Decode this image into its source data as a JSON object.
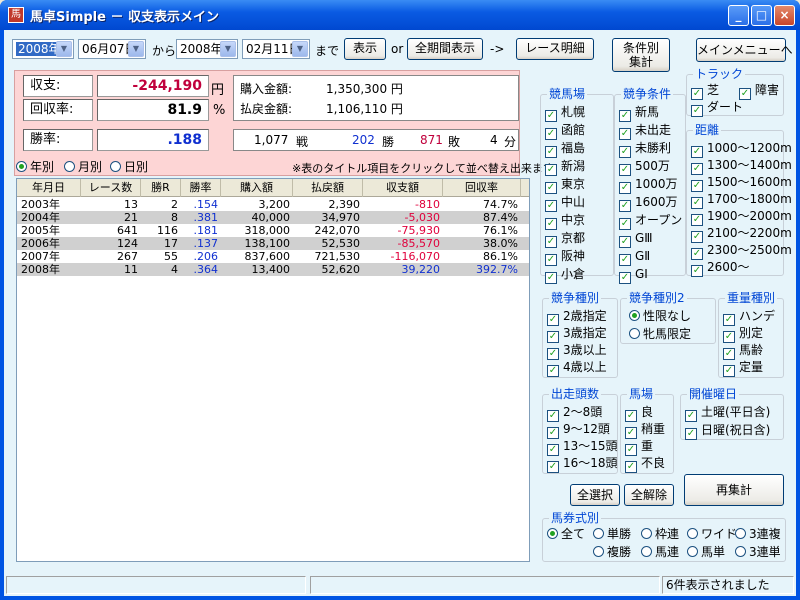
{
  "window": {
    "title": "馬卓Simple － 収支表示メイン",
    "icon": "馬"
  },
  "controls": {
    "year_from": "2008年",
    "date_from": "06月07日",
    "kara": "から",
    "year_to": "2008年",
    "date_to": "02月11日",
    "made": "まで",
    "show_btn": "表示",
    "or": "or",
    "all_period_btn": "全期間表示",
    "arrow": "->",
    "race_detail_btn": "レース明細",
    "cond_agg_btn_1": "条件別",
    "cond_agg_btn_2": "集計",
    "main_menu_btn": "メインメニューへ"
  },
  "summary": {
    "shushi_label": "収支:",
    "shushi_value": "-244,190",
    "yen": "円",
    "kaishu_label": "回収率:",
    "kaishu_value": "81.9",
    "pct": "%",
    "shoritsu_label": "勝率:",
    "shoritsu_value": ".188",
    "buy_label": "購入金額:",
    "buy_value": "1,350,300 円",
    "refund_label": "払戻金額:",
    "refund_value": "1,106,110 円",
    "races": "1,077",
    "sen": "戦",
    "wins": "202",
    "sho": "勝",
    "losses": "871",
    "hai": "敗",
    "draws": "4",
    "bun": "分"
  },
  "period": {
    "yearly": "年別",
    "monthly": "月別",
    "daily": "日別",
    "note": "※表のタイトル項目をクリックして並べ替え出来ます"
  },
  "table": {
    "headers": [
      "年月日",
      "レース数",
      "勝R",
      "勝率",
      "購入額",
      "払戻額",
      "収支額",
      "回収率"
    ],
    "rows": [
      [
        "2003年",
        "13",
        "2",
        ".154",
        "3,200",
        "2,390",
        "-810",
        "74.7%"
      ],
      [
        "2004年",
        "21",
        "8",
        ".381",
        "40,000",
        "34,970",
        "-5,030",
        "87.4%"
      ],
      [
        "2005年",
        "641",
        "116",
        ".181",
        "318,000",
        "242,070",
        "-75,930",
        "76.1%"
      ],
      [
        "2006年",
        "124",
        "17",
        ".137",
        "138,100",
        "52,530",
        "-85,570",
        "38.0%"
      ],
      [
        "2007年",
        "267",
        "55",
        ".206",
        "837,600",
        "721,530",
        "-116,070",
        "86.1%"
      ],
      [
        "2008年",
        "11",
        "4",
        ".364",
        "13,400",
        "52,620",
        "39,220",
        "392.7%"
      ]
    ]
  },
  "filters": {
    "keibajo": {
      "title": "競馬場",
      "items": [
        "札幌",
        "函館",
        "福島",
        "新潟",
        "東京",
        "中山",
        "中京",
        "京都",
        "阪神",
        "小倉"
      ]
    },
    "joken": {
      "title": "競争条件",
      "items": [
        "新馬",
        "未出走",
        "未勝利",
        "500万",
        "1000万",
        "1600万",
        "オープン",
        "GⅢ",
        "GⅡ",
        "GⅠ"
      ]
    },
    "track": {
      "title": "トラック",
      "items": [
        "芝",
        "障害",
        "ダート"
      ]
    },
    "kyori": {
      "title": "距離",
      "items": [
        "1000～1200m",
        "1300～1400m",
        "1500～1600m",
        "1700～1800m",
        "1900～2000m",
        "2100～2200m",
        "2300～2500m",
        "2600～"
      ]
    },
    "shubetsu": {
      "title": "競争種別",
      "items": [
        "2歳指定",
        "3歳指定",
        "3歳以上",
        "4歳以上"
      ]
    },
    "shubetsu2": {
      "title": "競争種別2",
      "items": [
        "性限なし",
        "牝馬限定"
      ]
    },
    "juryo": {
      "title": "重量種別",
      "items": [
        "ハンデ",
        "別定",
        "馬齢",
        "定量"
      ]
    },
    "tosu": {
      "title": "出走頭数",
      "items": [
        "2～8頭",
        "9～12頭",
        "13～15頭",
        "16～18頭"
      ]
    },
    "baba": {
      "title": "馬場",
      "items": [
        "良",
        "稍重",
        "重",
        "不良"
      ]
    },
    "youbi": {
      "title": "開催曜日",
      "items": [
        "土曜(平日含)",
        "日曜(祝日含)"
      ]
    },
    "baken": {
      "title": "馬券式別",
      "items": [
        "全て",
        "単勝",
        "枠連",
        "ワイド",
        "3連複",
        "複勝",
        "馬連",
        "馬単",
        "3連単"
      ]
    }
  },
  "buttons": {
    "select_all": "全選択",
    "clear_all": "全解除",
    "reaggregate": "再集計"
  },
  "status": {
    "message": "6件表示されました"
  },
  "colors": {
    "negative": "#e0003c",
    "blue": "#1030d0"
  }
}
